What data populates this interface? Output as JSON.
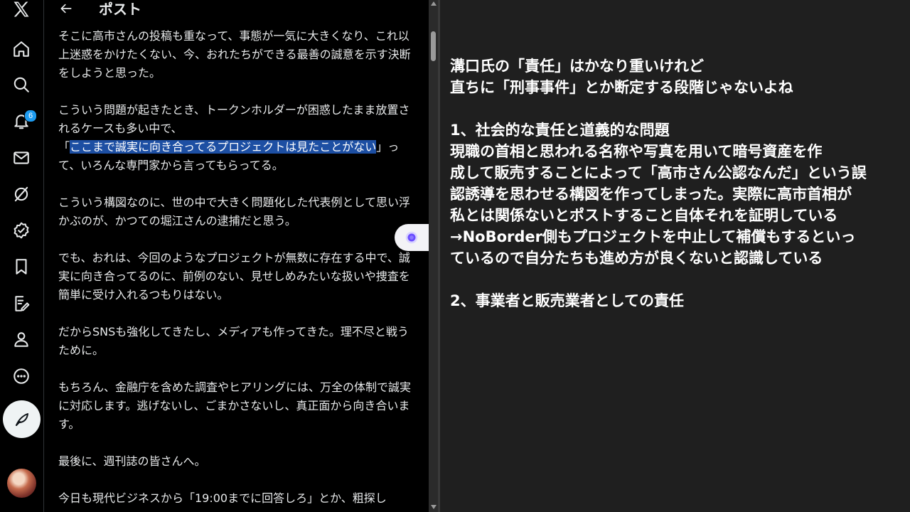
{
  "header": {
    "title": "ポスト"
  },
  "nav": {
    "notifications_badge": "6"
  },
  "post": {
    "paragraphs": [
      [
        {
          "text": "そこに高市さんの投稿も重なって、事態が一気に大きくなり、これ以上迷惑をかけたくない、今、おれたちができる最善の誠意を示す決断をしようと思った。"
        }
      ],
      [
        {
          "text": "こういう問題が起きたとき、トークンホルダーが困惑したまま放置されるケースも多い中で、\n「"
        },
        {
          "text": "ここまで誠実に向き合ってるプロジェクトは見たことがない",
          "highlight": true
        },
        {
          "text": "」って、いろんな専門家から言ってもらってる。"
        }
      ],
      [
        {
          "text": "こういう構図なのに、世の中で大きく問題化した代表例として思い浮かぶのが、かつての堀江さんの逮捕だと思う。"
        }
      ],
      [
        {
          "text": "でも、おれは、今回のようなプロジェクトが無数に存在する中で、誠実に向き合ってるのに、前例のない、見せしめみたいな扱いや捜査を簡単に受け入れるつもりはない。"
        }
      ],
      [
        {
          "text": "だからSNSも強化してきたし、メディアも作ってきた。理不尽と戦うために。"
        }
      ],
      [
        {
          "text": "もちろん、金融庁を含めた調査やヒアリングには、万全の体制で誠実に対応します。逃げないし、ごまかさないし、真正面から向き合います。"
        }
      ],
      [
        {
          "text": "最後に、週刊誌の皆さんへ。"
        }
      ],
      [
        {
          "text": "今日も現代ビジネスから「19:00までに回答しろ」とか、粗探し"
        }
      ]
    ]
  },
  "note": {
    "lines": [
      "溝口氏の「責任」はかなり重いけれど",
      "直ちに「刑事事件」とか断定する段階じゃないよね",
      "",
      "1、社会的な責任と道義的な問題",
      "現職の首相と思われる名称や写真を用いて暗号資産を作",
      "成して販売することによって「高市さん公認なんだ」という誤",
      "認誘導を思わせる構図を作ってしまった。実際に高市首相が",
      "私とは関係ないとポストすること自体それを証明している",
      "→NoBorder側もプロジェクトを中止して補償もするといっ",
      "ているので自分たちも進め方が良くないと認識している",
      "",
      "2、事業者と販売業者としての責任"
    ]
  },
  "colors": {
    "background": "#000000",
    "text": "#e7e9ea",
    "highlight": "#1d4fa3",
    "badge": "#1d9bf0",
    "note_background": "#1f1f1f",
    "note_text": "#ffffff"
  },
  "icons": [
    "x-logo-icon",
    "home-icon",
    "search-icon",
    "bell-icon",
    "mail-icon",
    "grok-slash-icon",
    "verified-icon",
    "bookmark-icon",
    "edit-note-icon",
    "profile-icon",
    "more-icon",
    "compose-icon",
    "back-arrow-icon",
    "grok-icon"
  ]
}
